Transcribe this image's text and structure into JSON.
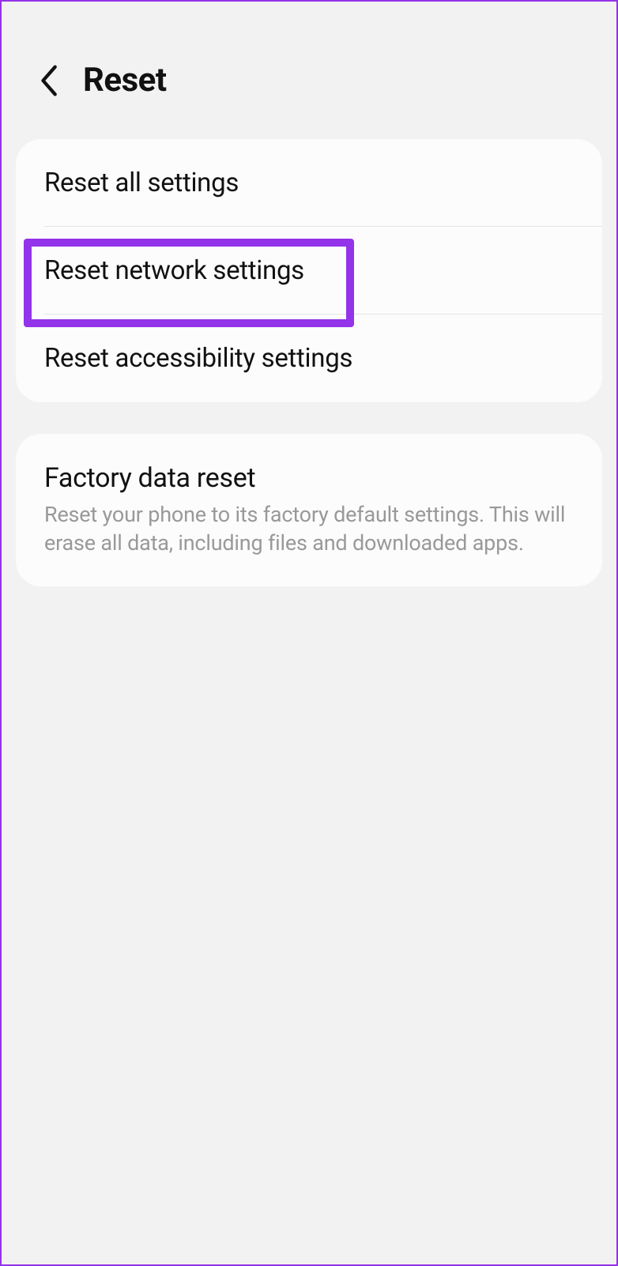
{
  "header": {
    "title": "Reset"
  },
  "group1": {
    "items": [
      {
        "label": "Reset all settings"
      },
      {
        "label": "Reset network settings",
        "highlighted": true
      },
      {
        "label": "Reset accessibility settings"
      }
    ]
  },
  "group2": {
    "items": [
      {
        "label": "Factory data reset",
        "subtitle": "Reset your phone to its factory default settings. This will erase all data, including files and downloaded apps."
      }
    ]
  },
  "colors": {
    "highlight": "#9333ea",
    "background": "#f2f2f2",
    "card": "#fcfcfc",
    "text": "#111",
    "subtitle": "#999"
  }
}
